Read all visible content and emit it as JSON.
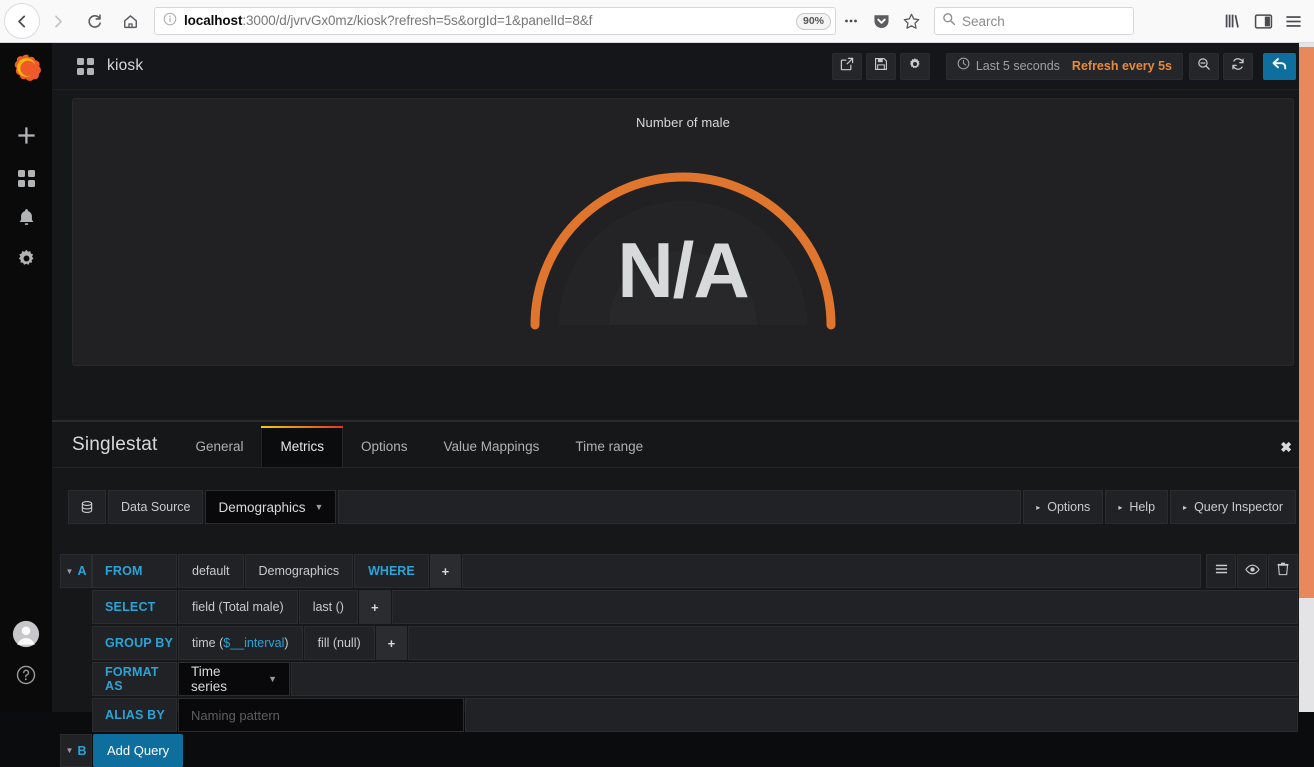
{
  "browser": {
    "nav": {
      "back_icon": "arrow-left-icon",
      "forward_icon": "arrow-right-icon",
      "reload_icon": "reload-icon",
      "home_icon": "home-icon"
    },
    "url": {
      "info_icon": "info-circle-icon",
      "host": "localhost",
      "path": ":3000/d/jvrvGx0mz/kiosk?refresh=5s&orgId=1&panelId=8&f",
      "zoom_level": "90%"
    },
    "actions": {
      "page_actions_icon": "ellipsis-icon",
      "pocket_icon": "pocket-shield-icon",
      "bookmark_icon": "star-icon"
    },
    "search": {
      "placeholder": "Search",
      "icon": "search-icon"
    },
    "right": {
      "library_icon": "library-icon",
      "sidebar_icon": "sidebar-icon",
      "menu_icon": "hamburger-menu-icon"
    }
  },
  "sidemenu": {
    "logo": "grafana-logo-icon",
    "items": [
      {
        "name": "create",
        "icon": "plus-icon"
      },
      {
        "name": "dashboards",
        "icon": "grid-icon"
      },
      {
        "name": "alerting",
        "icon": "bell-icon"
      },
      {
        "name": "configuration",
        "icon": "gear-icon"
      }
    ],
    "bottom": [
      {
        "name": "user-profile",
        "icon": "avatar-icon"
      },
      {
        "name": "help",
        "icon": "question-circle-icon"
      }
    ]
  },
  "topnav": {
    "dashboard_icon": "dashboard-grid-icon",
    "title": "kiosk",
    "share_icon": "share-icon",
    "save_icon": "save-icon",
    "settings_icon": "gear-icon",
    "time_icon": "clock-icon",
    "time_range": "Last 5 seconds",
    "refresh_interval": "Refresh every 5s",
    "zoom_out_icon": "zoom-out-icon",
    "refresh_icon": "refresh-icon",
    "back_icon": "back-arrow-icon"
  },
  "panel": {
    "title": "Number of male",
    "value": "N/A",
    "gauge_color": "#e0752d",
    "gauge_track_color": "#2b2b2e"
  },
  "editor": {
    "panel_type": "Singlestat",
    "tabs": [
      {
        "label": "General",
        "active": false
      },
      {
        "label": "Metrics",
        "active": true
      },
      {
        "label": "Options",
        "active": false
      },
      {
        "label": "Value Mappings",
        "active": false
      },
      {
        "label": "Time range",
        "active": false
      }
    ],
    "close_label": "✖",
    "datasource": {
      "icon": "database-icon",
      "label": "Data Source",
      "value": "Demographics",
      "caret": "▼"
    },
    "right_buttons": [
      {
        "label": "Options",
        "caret": "▸"
      },
      {
        "label": "Help",
        "caret": "▸"
      },
      {
        "label": "Query Inspector",
        "caret": "▸"
      }
    ],
    "query": {
      "letter": "A",
      "collapse_caret": "▼",
      "from": {
        "label": "FROM",
        "policy": "default",
        "measurement": "Demographics",
        "where": "WHERE",
        "add": "+"
      },
      "select": {
        "label": "SELECT",
        "field": "field (Total male)",
        "func": "last ()",
        "add": "+"
      },
      "group_by": {
        "label": "GROUP BY",
        "time_prefix": "time (",
        "time_var": "$__interval",
        "time_suffix": ")",
        "fill": "fill (null)",
        "add": "+"
      },
      "format_as": {
        "label": "FORMAT AS",
        "value": "Time series",
        "caret": "▼"
      },
      "alias_by": {
        "label": "ALIAS BY",
        "placeholder": "Naming pattern",
        "value": ""
      },
      "tools": [
        {
          "name": "query-menu",
          "icon": "hamburger-icon"
        },
        {
          "name": "toggle-query",
          "icon": "eye-icon"
        },
        {
          "name": "remove-query",
          "icon": "trash-icon"
        }
      ]
    },
    "query_b": {
      "letter": "B",
      "collapse_caret": "▼"
    },
    "add_query_label": "Add Query"
  },
  "scrollbar": {
    "thumb_color": "#e8895c",
    "track_color": "#e4e4e6"
  }
}
